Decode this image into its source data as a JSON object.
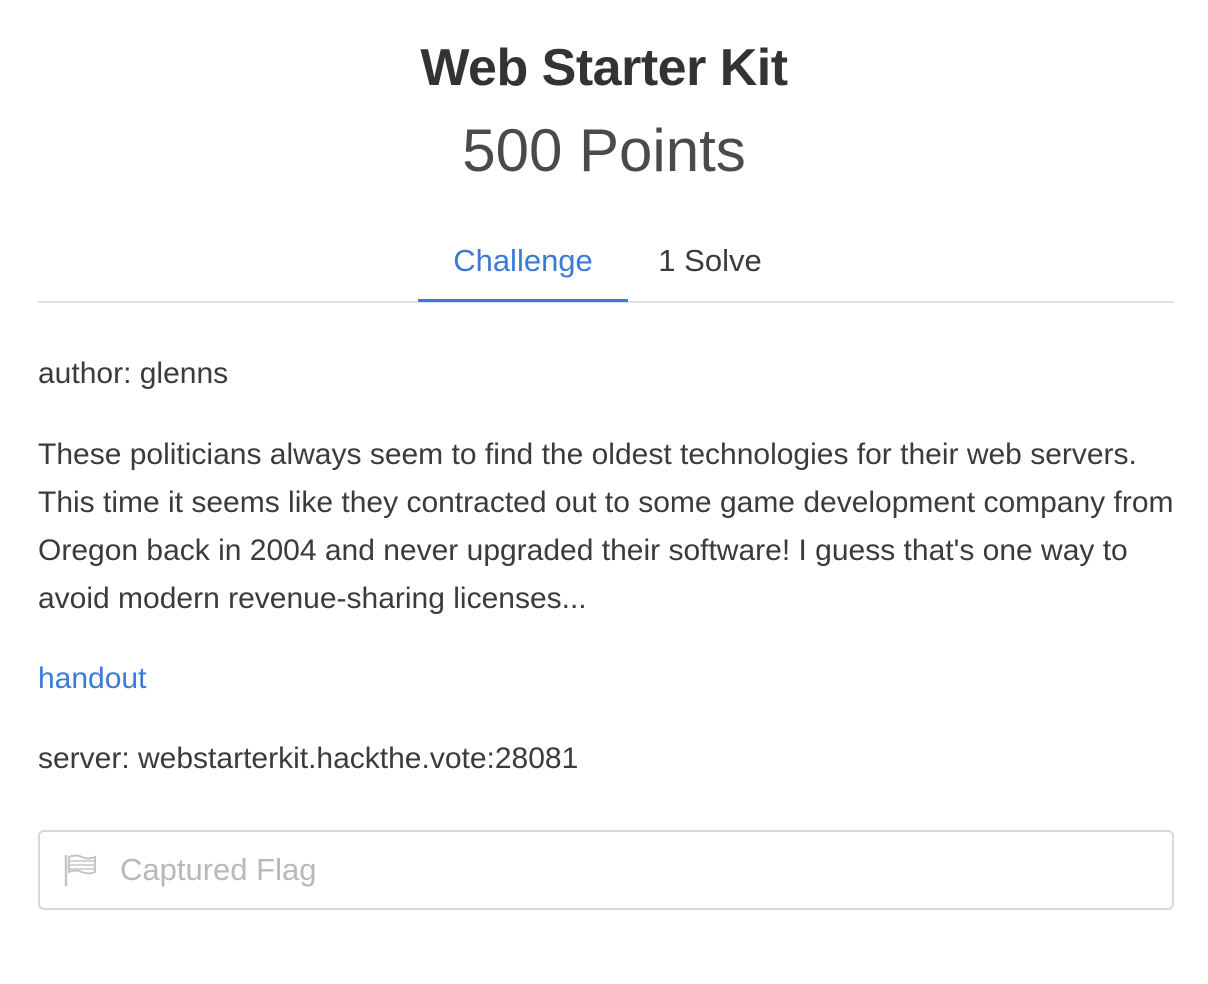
{
  "challenge": {
    "title": "Web Starter Kit",
    "points": "500 Points"
  },
  "tabs": [
    {
      "label": "Challenge",
      "active": true
    },
    {
      "label": "1 Solve",
      "active": false
    }
  ],
  "body": {
    "author": "author: glenns",
    "description": "These politicians always seem to find the oldest technologies for their web servers. This time it seems like they contracted out to some game development company from Oregon back in 2004 and never upgraded their software! I guess that's one way to avoid modern revenue-sharing licenses...",
    "handout_link": "handout",
    "server": "server: webstarterkit.hackthe.vote:28081"
  },
  "flag_input": {
    "placeholder": "Captured Flag",
    "value": "",
    "icon": "flag-icon"
  },
  "colors": {
    "accent": "#3a7bd5",
    "text": "#3b3b3b",
    "border": "#dee2e6",
    "placeholder": "#b6b9bc"
  }
}
